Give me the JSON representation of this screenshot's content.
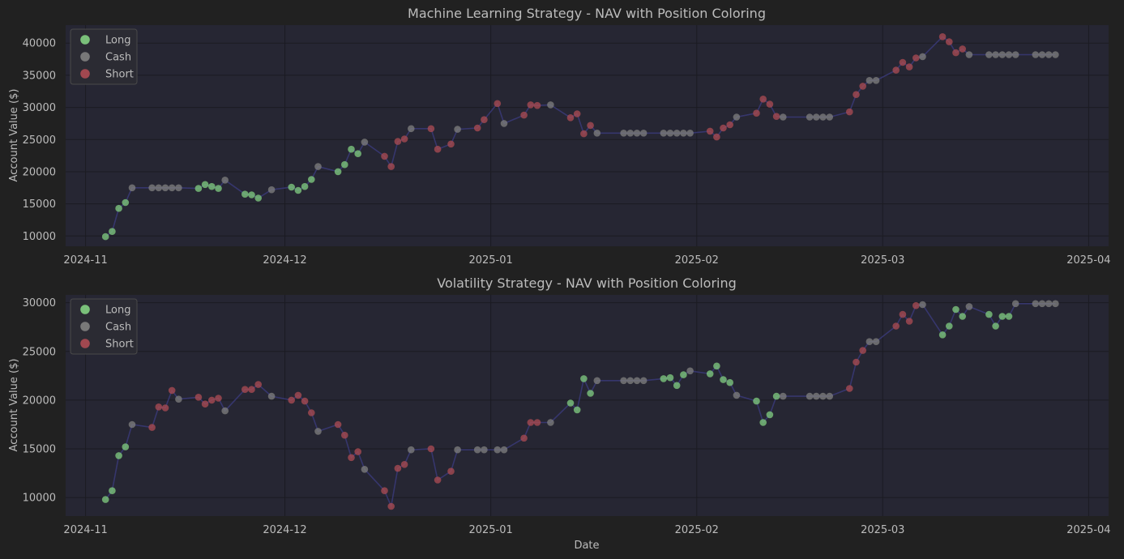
{
  "colors": {
    "background": "#212121",
    "plot_bg": "#262633",
    "grid": "#1b1b22",
    "text": "#bcbcbc",
    "line": "#3a3a78",
    "long": "#7ec87e",
    "cash": "#7c7c7c",
    "short": "#a84a52"
  },
  "xlabel": "Date",
  "chart_data": [
    {
      "type": "scatter",
      "title": "Machine Learning Strategy - NAV with Position Coloring",
      "ylabel": "Account Value ($)",
      "xlabel": "",
      "xlim": [
        "2024-10-29",
        "2025-04-04"
      ],
      "ylim": [
        8400,
        42800
      ],
      "x_ticks": [
        "2024-11",
        "2024-12",
        "2025-01",
        "2025-02",
        "2025-03",
        "2025-04"
      ],
      "y_ticks": [
        10000,
        15000,
        20000,
        25000,
        30000,
        35000,
        40000
      ],
      "legend": {
        "position": "top-left",
        "entries": [
          {
            "key": "L",
            "label": "Long"
          },
          {
            "key": "C",
            "label": "Cash"
          },
          {
            "key": "S",
            "label": "Short"
          }
        ]
      },
      "points": [
        [
          "2024-11-04",
          9900,
          "L"
        ],
        [
          "2024-11-05",
          10700,
          "L"
        ],
        [
          "2024-11-06",
          14300,
          "L"
        ],
        [
          "2024-11-07",
          15200,
          "L"
        ],
        [
          "2024-11-08",
          17500,
          "C"
        ],
        [
          "2024-11-11",
          17500,
          "C"
        ],
        [
          "2024-11-12",
          17500,
          "C"
        ],
        [
          "2024-11-13",
          17500,
          "C"
        ],
        [
          "2024-11-14",
          17500,
          "C"
        ],
        [
          "2024-11-15",
          17500,
          "C"
        ],
        [
          "2024-11-18",
          17400,
          "L"
        ],
        [
          "2024-11-19",
          18000,
          "L"
        ],
        [
          "2024-11-20",
          17700,
          "L"
        ],
        [
          "2024-11-21",
          17400,
          "L"
        ],
        [
          "2024-11-22",
          18700,
          "C"
        ],
        [
          "2024-11-25",
          16500,
          "L"
        ],
        [
          "2024-11-26",
          16400,
          "L"
        ],
        [
          "2024-11-27",
          15900,
          "L"
        ],
        [
          "2024-11-29",
          17200,
          "C"
        ],
        [
          "2024-12-02",
          17600,
          "L"
        ],
        [
          "2024-12-03",
          17100,
          "L"
        ],
        [
          "2024-12-04",
          17700,
          "L"
        ],
        [
          "2024-12-05",
          18800,
          "L"
        ],
        [
          "2024-12-06",
          20800,
          "C"
        ],
        [
          "2024-12-09",
          20000,
          "L"
        ],
        [
          "2024-12-10",
          21100,
          "L"
        ],
        [
          "2024-12-11",
          23500,
          "L"
        ],
        [
          "2024-12-12",
          22800,
          "L"
        ],
        [
          "2024-12-13",
          24600,
          "C"
        ],
        [
          "2024-12-16",
          22400,
          "S"
        ],
        [
          "2024-12-17",
          20800,
          "S"
        ],
        [
          "2024-12-18",
          24700,
          "S"
        ],
        [
          "2024-12-19",
          25100,
          "S"
        ],
        [
          "2024-12-20",
          26700,
          "C"
        ],
        [
          "2024-12-23",
          26700,
          "S"
        ],
        [
          "2024-12-24",
          23500,
          "S"
        ],
        [
          "2024-12-26",
          24300,
          "S"
        ],
        [
          "2024-12-27",
          26600,
          "C"
        ],
        [
          "2024-12-30",
          26800,
          "S"
        ],
        [
          "2024-12-31",
          28100,
          "S"
        ],
        [
          "2025-01-02",
          30600,
          "S"
        ],
        [
          "2025-01-03",
          27500,
          "C"
        ],
        [
          "2025-01-06",
          28800,
          "S"
        ],
        [
          "2025-01-07",
          30400,
          "S"
        ],
        [
          "2025-01-08",
          30300,
          "S"
        ],
        [
          "2025-01-10",
          30400,
          "C"
        ],
        [
          "2025-01-13",
          28400,
          "S"
        ],
        [
          "2025-01-14",
          29000,
          "S"
        ],
        [
          "2025-01-15",
          25900,
          "S"
        ],
        [
          "2025-01-16",
          27200,
          "S"
        ],
        [
          "2025-01-17",
          26000,
          "C"
        ],
        [
          "2025-01-21",
          26000,
          "C"
        ],
        [
          "2025-01-22",
          26000,
          "C"
        ],
        [
          "2025-01-23",
          26000,
          "C"
        ],
        [
          "2025-01-24",
          26000,
          "C"
        ],
        [
          "2025-01-27",
          26000,
          "C"
        ],
        [
          "2025-01-28",
          26000,
          "C"
        ],
        [
          "2025-01-29",
          26000,
          "C"
        ],
        [
          "2025-01-30",
          26000,
          "C"
        ],
        [
          "2025-01-31",
          26000,
          "C"
        ],
        [
          "2025-02-03",
          26300,
          "S"
        ],
        [
          "2025-02-04",
          25400,
          "S"
        ],
        [
          "2025-02-05",
          26800,
          "S"
        ],
        [
          "2025-02-06",
          27300,
          "S"
        ],
        [
          "2025-02-07",
          28500,
          "C"
        ],
        [
          "2025-02-10",
          29100,
          "S"
        ],
        [
          "2025-02-11",
          31300,
          "S"
        ],
        [
          "2025-02-12",
          30500,
          "S"
        ],
        [
          "2025-02-13",
          28600,
          "S"
        ],
        [
          "2025-02-14",
          28500,
          "C"
        ],
        [
          "2025-02-18",
          28500,
          "C"
        ],
        [
          "2025-02-19",
          28500,
          "C"
        ],
        [
          "2025-02-20",
          28500,
          "C"
        ],
        [
          "2025-02-21",
          28500,
          "C"
        ],
        [
          "2025-02-24",
          29300,
          "S"
        ],
        [
          "2025-02-25",
          32000,
          "S"
        ],
        [
          "2025-02-26",
          33300,
          "S"
        ],
        [
          "2025-02-27",
          34200,
          "C"
        ],
        [
          "2025-02-28",
          34200,
          "C"
        ],
        [
          "2025-03-03",
          35800,
          "S"
        ],
        [
          "2025-03-04",
          37000,
          "S"
        ],
        [
          "2025-03-05",
          36300,
          "S"
        ],
        [
          "2025-03-06",
          37700,
          "S"
        ],
        [
          "2025-03-07",
          37900,
          "C"
        ],
        [
          "2025-03-10",
          41000,
          "S"
        ],
        [
          "2025-03-11",
          40200,
          "S"
        ],
        [
          "2025-03-12",
          38500,
          "S"
        ],
        [
          "2025-03-13",
          39100,
          "S"
        ],
        [
          "2025-03-14",
          38200,
          "C"
        ],
        [
          "2025-03-17",
          38200,
          "C"
        ],
        [
          "2025-03-18",
          38200,
          "C"
        ],
        [
          "2025-03-19",
          38200,
          "C"
        ],
        [
          "2025-03-20",
          38200,
          "C"
        ],
        [
          "2025-03-21",
          38200,
          "C"
        ],
        [
          "2025-03-24",
          38200,
          "C"
        ],
        [
          "2025-03-25",
          38200,
          "C"
        ],
        [
          "2025-03-26",
          38200,
          "C"
        ],
        [
          "2025-03-27",
          38200,
          "C"
        ]
      ]
    },
    {
      "type": "scatter",
      "title": "Volatility Strategy - NAV with Position Coloring",
      "ylabel": "Account Value ($)",
      "xlabel": "Date",
      "xlim": [
        "2024-10-29",
        "2025-04-04"
      ],
      "ylim": [
        8100,
        30800
      ],
      "x_ticks": [
        "2024-11",
        "2024-12",
        "2025-01",
        "2025-02",
        "2025-03",
        "2025-04"
      ],
      "y_ticks": [
        10000,
        15000,
        20000,
        25000,
        30000
      ],
      "legend": {
        "position": "top-left",
        "entries": [
          {
            "key": "L",
            "label": "Long"
          },
          {
            "key": "C",
            "label": "Cash"
          },
          {
            "key": "S",
            "label": "Short"
          }
        ]
      },
      "points": [
        [
          "2024-11-04",
          9800,
          "L"
        ],
        [
          "2024-11-05",
          10700,
          "L"
        ],
        [
          "2024-11-06",
          14300,
          "L"
        ],
        [
          "2024-11-07",
          15200,
          "L"
        ],
        [
          "2024-11-08",
          17500,
          "C"
        ],
        [
          "2024-11-11",
          17200,
          "S"
        ],
        [
          "2024-11-12",
          19300,
          "S"
        ],
        [
          "2024-11-13",
          19200,
          "S"
        ],
        [
          "2024-11-14",
          21000,
          "S"
        ],
        [
          "2024-11-15",
          20100,
          "C"
        ],
        [
          "2024-11-18",
          20300,
          "S"
        ],
        [
          "2024-11-19",
          19600,
          "S"
        ],
        [
          "2024-11-20",
          20000,
          "S"
        ],
        [
          "2024-11-21",
          20200,
          "S"
        ],
        [
          "2024-11-22",
          18900,
          "C"
        ],
        [
          "2024-11-25",
          21100,
          "S"
        ],
        [
          "2024-11-26",
          21100,
          "S"
        ],
        [
          "2024-11-27",
          21600,
          "S"
        ],
        [
          "2024-11-29",
          20400,
          "C"
        ],
        [
          "2024-12-02",
          20000,
          "S"
        ],
        [
          "2024-12-03",
          20500,
          "S"
        ],
        [
          "2024-12-04",
          19900,
          "S"
        ],
        [
          "2024-12-05",
          18700,
          "S"
        ],
        [
          "2024-12-06",
          16800,
          "C"
        ],
        [
          "2024-12-09",
          17500,
          "S"
        ],
        [
          "2024-12-10",
          16400,
          "S"
        ],
        [
          "2024-12-11",
          14100,
          "S"
        ],
        [
          "2024-12-12",
          14700,
          "S"
        ],
        [
          "2024-12-13",
          12900,
          "C"
        ],
        [
          "2024-12-16",
          10700,
          "S"
        ],
        [
          "2024-12-17",
          9100,
          "S"
        ],
        [
          "2024-12-18",
          13000,
          "S"
        ],
        [
          "2024-12-19",
          13400,
          "S"
        ],
        [
          "2024-12-20",
          14900,
          "C"
        ],
        [
          "2024-12-23",
          15000,
          "S"
        ],
        [
          "2024-12-24",
          11800,
          "S"
        ],
        [
          "2024-12-26",
          12700,
          "S"
        ],
        [
          "2024-12-27",
          14900,
          "C"
        ],
        [
          "2024-12-30",
          14900,
          "C"
        ],
        [
          "2024-12-31",
          14900,
          "C"
        ],
        [
          "2025-01-02",
          14900,
          "C"
        ],
        [
          "2025-01-03",
          14900,
          "C"
        ],
        [
          "2025-01-06",
          16100,
          "S"
        ],
        [
          "2025-01-07",
          17700,
          "S"
        ],
        [
          "2025-01-08",
          17700,
          "S"
        ],
        [
          "2025-01-10",
          17700,
          "C"
        ],
        [
          "2025-01-13",
          19700,
          "L"
        ],
        [
          "2025-01-14",
          19000,
          "L"
        ],
        [
          "2025-01-15",
          22200,
          "L"
        ],
        [
          "2025-01-16",
          20700,
          "L"
        ],
        [
          "2025-01-17",
          22000,
          "C"
        ],
        [
          "2025-01-21",
          22000,
          "C"
        ],
        [
          "2025-01-22",
          22000,
          "C"
        ],
        [
          "2025-01-23",
          22000,
          "C"
        ],
        [
          "2025-01-24",
          22000,
          "C"
        ],
        [
          "2025-01-27",
          22200,
          "L"
        ],
        [
          "2025-01-28",
          22300,
          "L"
        ],
        [
          "2025-01-29",
          21500,
          "L"
        ],
        [
          "2025-01-30",
          22600,
          "L"
        ],
        [
          "2025-01-31",
          23000,
          "C"
        ],
        [
          "2025-02-03",
          22700,
          "L"
        ],
        [
          "2025-02-04",
          23500,
          "L"
        ],
        [
          "2025-02-05",
          22100,
          "L"
        ],
        [
          "2025-02-06",
          21800,
          "L"
        ],
        [
          "2025-02-07",
          20500,
          "C"
        ],
        [
          "2025-02-10",
          19900,
          "L"
        ],
        [
          "2025-02-11",
          17700,
          "L"
        ],
        [
          "2025-02-12",
          18500,
          "L"
        ],
        [
          "2025-02-13",
          20400,
          "L"
        ],
        [
          "2025-02-14",
          20400,
          "C"
        ],
        [
          "2025-02-18",
          20400,
          "C"
        ],
        [
          "2025-02-19",
          20400,
          "C"
        ],
        [
          "2025-02-20",
          20400,
          "C"
        ],
        [
          "2025-02-21",
          20400,
          "C"
        ],
        [
          "2025-02-24",
          21200,
          "S"
        ],
        [
          "2025-02-25",
          23900,
          "S"
        ],
        [
          "2025-02-26",
          25100,
          "S"
        ],
        [
          "2025-02-27",
          26000,
          "C"
        ],
        [
          "2025-02-28",
          26000,
          "C"
        ],
        [
          "2025-03-03",
          27600,
          "S"
        ],
        [
          "2025-03-04",
          28800,
          "S"
        ],
        [
          "2025-03-05",
          28100,
          "S"
        ],
        [
          "2025-03-06",
          29700,
          "S"
        ],
        [
          "2025-03-07",
          29800,
          "C"
        ],
        [
          "2025-03-10",
          26700,
          "L"
        ],
        [
          "2025-03-11",
          27600,
          "L"
        ],
        [
          "2025-03-12",
          29300,
          "L"
        ],
        [
          "2025-03-13",
          28600,
          "L"
        ],
        [
          "2025-03-14",
          29600,
          "C"
        ],
        [
          "2025-03-17",
          28800,
          "L"
        ],
        [
          "2025-03-18",
          27600,
          "L"
        ],
        [
          "2025-03-19",
          28600,
          "L"
        ],
        [
          "2025-03-20",
          28600,
          "L"
        ],
        [
          "2025-03-21",
          29900,
          "C"
        ],
        [
          "2025-03-24",
          29900,
          "C"
        ],
        [
          "2025-03-25",
          29900,
          "C"
        ],
        [
          "2025-03-26",
          29900,
          "C"
        ],
        [
          "2025-03-27",
          29900,
          "C"
        ]
      ]
    }
  ]
}
